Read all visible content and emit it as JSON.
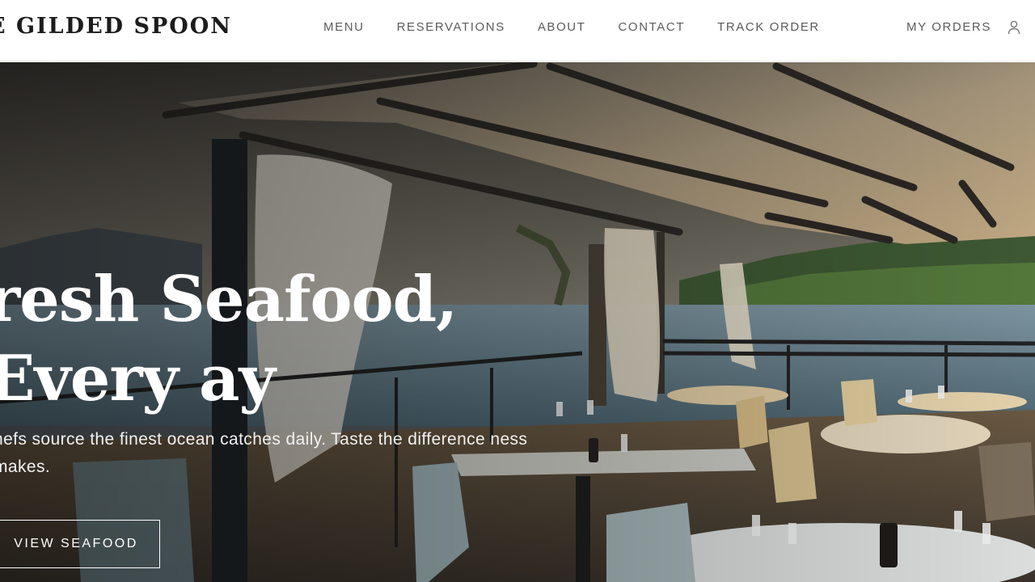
{
  "brand": {
    "name": "E GILDED SPOON"
  },
  "nav": {
    "items": [
      {
        "label": "MENU"
      },
      {
        "label": "RESERVATIONS"
      },
      {
        "label": "ABOUT"
      },
      {
        "label": "CONTACT"
      },
      {
        "label": "TRACK ORDER"
      }
    ],
    "orders_label": "MY ORDERS",
    "user_icon": "user-icon"
  },
  "hero": {
    "title": "resh Seafood, Every ay",
    "subtitle": "hefs source the finest ocean catches daily. Taste the difference ness makes.",
    "button_label": "VIEW SEAFOOD"
  },
  "colors": {
    "header_bg": "#ffffff",
    "nav_text": "#5b5b5b",
    "brand_text": "#1c1c1c",
    "hero_text": "#ffffff"
  }
}
